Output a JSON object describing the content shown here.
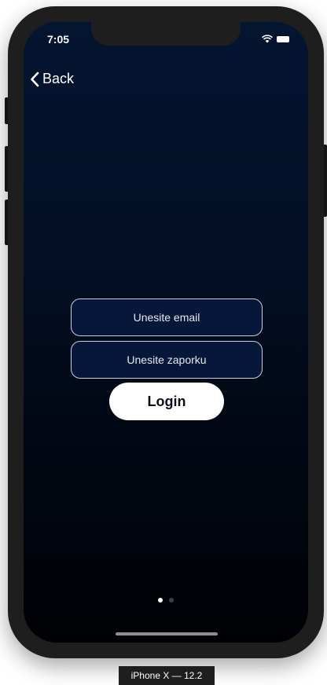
{
  "status_bar": {
    "time": "7:05"
  },
  "nav": {
    "back_label": "Back"
  },
  "login_form": {
    "email_placeholder": "Unesite email",
    "password_placeholder": "Unesite zaporku",
    "login_label": "Login"
  },
  "pager": {
    "page_count": 2,
    "active_index": 0,
    "active_color": "#ffffff",
    "inactive_color": "#3a3f4a"
  },
  "device_label": "iPhone X — 12.2",
  "colors": {
    "background_top": "#041530",
    "background_bottom": "#000105",
    "field_border": "#c9d0da",
    "button_background": "#ffffff"
  }
}
